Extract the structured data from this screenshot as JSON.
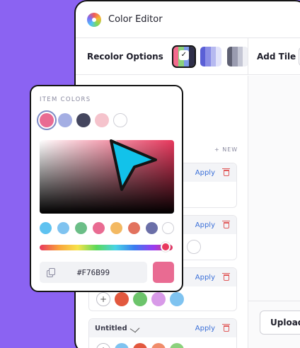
{
  "app": {
    "title": "Color Editor",
    "logo_icon": "color-wheel-icon"
  },
  "toolbar": {
    "recolor_label": "Recolor Options",
    "swatches": [
      {
        "colors": [
          "#F36A8D",
          "#8BD17C",
          "#7E9BE8",
          "#2F2F4A"
        ],
        "selected": true
      },
      {
        "colors": [
          "#5A5FD6",
          "#8A8DE6",
          "#B6B9F0",
          "#E2E3FA"
        ],
        "selected": false
      },
      {
        "colors": [
          "#5E6072",
          "#9A9CB0",
          "#C4C6D4",
          "#EEEFF4"
        ],
        "selected": false
      }
    ],
    "check_icon": "check-icon",
    "add_tile_label": "Add Tile"
  },
  "list": {
    "new_label": "+ NEW",
    "rows": [
      {
        "apply_label": "Apply",
        "dots": []
      },
      {
        "apply_label": "Apply",
        "dots": [
          "#FFFFFF"
        ]
      },
      {
        "apply_label": "Apply",
        "dots": [
          "#E2583E",
          "#6CC46B",
          "#D89AE8",
          "#7FC3F0"
        ]
      },
      {
        "name": "Untitled",
        "apply_label": "Apply",
        "dots": [
          "#7FC3F0",
          "#E2583E",
          "#F08C6A",
          "#8BD17C"
        ]
      }
    ],
    "add_symbol": "+"
  },
  "upload": {
    "label": "Upload"
  },
  "picker": {
    "title": "ITEM COLORS",
    "item_colors": [
      "#E96B92",
      "#A4AEE3",
      "#44465E",
      "#F5C3CC",
      "#FFFFFF"
    ],
    "presets": [
      "#5EC2F0",
      "#7FC3F0",
      "#6BBE87",
      "#E96B92",
      "#F3B962",
      "#E2725E",
      "#6B6FA8",
      "#FFFFFF"
    ],
    "hex_value": "#F76B99",
    "preview_color": "#E96B92"
  },
  "colors": {
    "accent_link": "#3A6FD8",
    "trash": "#E05A5A",
    "background": "#8B63F2",
    "cursor_fill": "#12C2EA"
  }
}
